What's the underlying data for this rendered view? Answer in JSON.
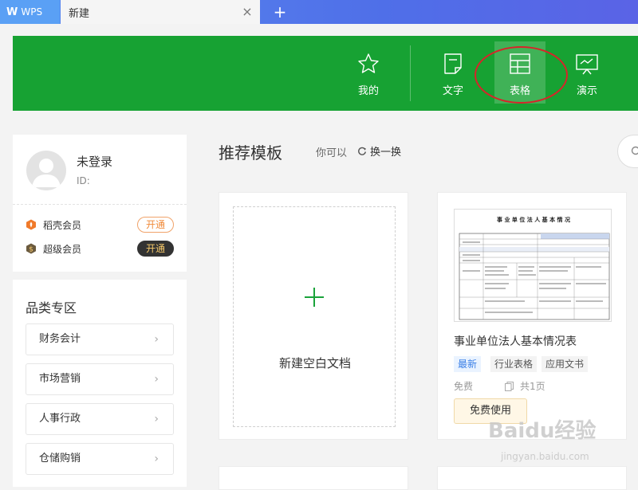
{
  "tabs": {
    "app_label": "WPS",
    "current_label": "新建",
    "close_symbol": "×",
    "add_symbol": "+"
  },
  "header": {
    "nav": [
      {
        "label": "我的",
        "icon": "star-icon"
      },
      {
        "label": "文字",
        "icon": "document-icon"
      },
      {
        "label": "表格",
        "icon": "spreadsheet-icon",
        "active": true
      },
      {
        "label": "演示",
        "icon": "presentation-icon"
      }
    ],
    "color": "#17a233"
  },
  "user": {
    "name": "未登录",
    "id_label": "ID:",
    "memberships": [
      {
        "label": "稻壳会员",
        "button": "开通"
      },
      {
        "label": "超级会员",
        "button": "开通"
      }
    ]
  },
  "categories": {
    "title": "品类专区",
    "items": [
      "财务会计",
      "市场营销",
      "人事行政",
      "仓储购销"
    ]
  },
  "main": {
    "title": "推荐模板",
    "hint": "你可以",
    "refresh_label": "换一换",
    "blank_label": "新建空白文档",
    "template": {
      "name": "事业单位法人基本情况表",
      "thumb_title": "事 业 单 位 法 人 基 本 情 况",
      "tags": [
        "最新",
        "行业表格",
        "应用文书"
      ],
      "price": "免费",
      "pages": "共1页",
      "use_button": "免费使用"
    }
  },
  "watermark": {
    "text": "Baidu经验",
    "url": "jingyan.baidu.com"
  }
}
